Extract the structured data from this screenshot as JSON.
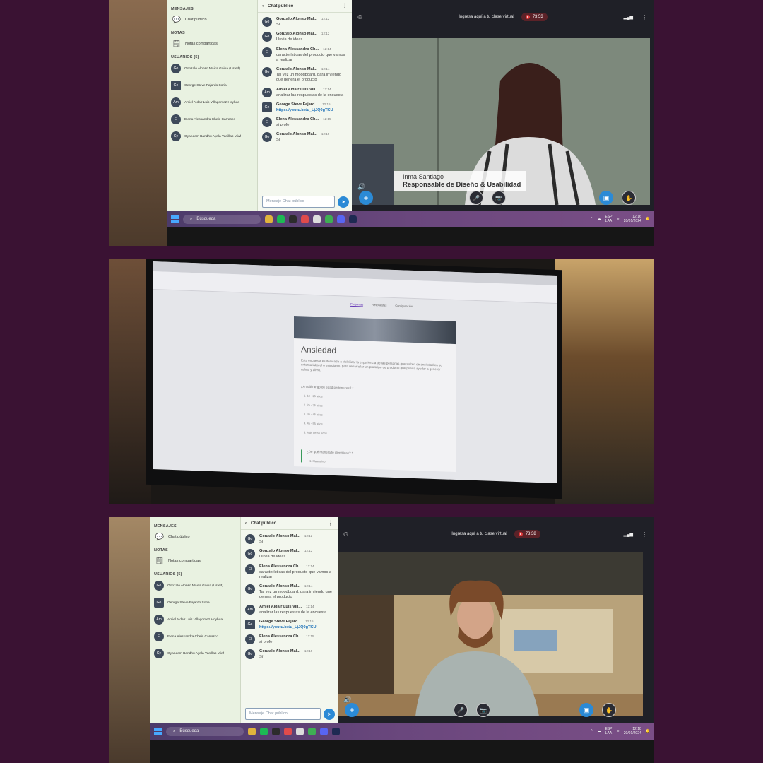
{
  "screens": [
    {
      "left_panel": {
        "messages_heading": "MENSAJES",
        "public_chat": "Chat público",
        "notes_heading": "NOTAS",
        "shared_notes": "Notas compartidas",
        "users_heading": "USUARIOS (5)",
        "users": [
          {
            "initials": "Go",
            "name": "Gonzalo Alonso Maica Goina (Usted)"
          },
          {
            "initials": "Ge",
            "name": "George Steve Fajardo Soria"
          },
          {
            "initials": "Am",
            "name": "Amiel Aldair Luis Villagomez Hoyhua"
          },
          {
            "initials": "El",
            "name": "Elena Alessandra Chele Carrasco"
          },
          {
            "initials": "Gy",
            "name": "Gyandem Bandhu Ayala Vanillas Miwl"
          }
        ]
      },
      "chat": {
        "title": "Chat público",
        "back": "‹",
        "more": "⋮",
        "messages": [
          {
            "initials": "Go",
            "sender": "Gonzalo Alonso Mal...",
            "time": "12:12",
            "text": "Sí"
          },
          {
            "initials": "Go",
            "sender": "Gonzalo Alonso Mal...",
            "time": "12:12",
            "text": "Lluvia de ideas"
          },
          {
            "initials": "El",
            "sender": "Elena Alessandra Ch...",
            "time": "12:14",
            "text": "características del producto que vamos a realizar"
          },
          {
            "initials": "Go",
            "sender": "Gonzalo Alonso Mal...",
            "time": "12:14",
            "text": "Tal vez un moodboard, para ir viendo que genera el producto"
          },
          {
            "initials": "Am",
            "sender": "Amiel Aldair Luis Vill...",
            "time": "12:14",
            "text": "analizar las respuestas de la encuesta"
          },
          {
            "initials": "Ge",
            "sender": "George Steve Fajard...",
            "time": "12:15",
            "text": "https://youtu.be/u_LjJQ0gTKU",
            "link": true
          },
          {
            "initials": "El",
            "sender": "Elena Alessandra Ch...",
            "time": "12:15",
            "text": "si profe"
          },
          {
            "initials": "Go",
            "sender": "Gonzalo Alonso Mal...",
            "time": "12:15",
            "text": "Sí"
          }
        ],
        "input_placeholder": "Mensaje Chat público",
        "send_icon": "➤"
      },
      "video": {
        "header_text": "Ingresa aquí a tu clase virtual",
        "timer": "73:53",
        "signal": "▂▄▆",
        "kebab": "⋮",
        "users_icon": "⚇",
        "banner_name": "Inma Santiago",
        "banner_role": "Responsable de Diseño & Usabilidad",
        "volume_icon": "🔊",
        "plus_icon": "+",
        "mic_icon": "🎤",
        "cam_icon": "📷",
        "share_icon": "▣",
        "hand_icon": "✋"
      },
      "taskbar": {
        "search_label": "Búsqueda",
        "lang_top": "ESP",
        "lang_bottom": "LAA",
        "time": "12:16",
        "date": "20/01/2024"
      }
    },
    {
      "left_panel": {
        "messages_heading": "MENSAJES",
        "public_chat": "Chat público",
        "notes_heading": "NOTAS",
        "shared_notes": "Notas compartidas",
        "users_heading": "USUARIOS (5)",
        "users": [
          {
            "initials": "Go",
            "name": "Gonzalo Alonso Maica Goina (Usted)"
          },
          {
            "initials": "Ge",
            "name": "George Steve Fajardo Soria"
          },
          {
            "initials": "Am",
            "name": "Amiel Aldair Luis Villagomez Hoyhua"
          },
          {
            "initials": "El",
            "name": "Elena Alessandra Chele Carrasco"
          },
          {
            "initials": "Gy",
            "name": "Gyandem Bandhu Ayala Vanillas Miwl"
          }
        ]
      },
      "chat": {
        "title": "Chat público",
        "back": "‹",
        "more": "⋮",
        "messages": [
          {
            "initials": "Go",
            "sender": "Gonzalo Alonso Mal...",
            "time": "12:12",
            "text": "Sí"
          },
          {
            "initials": "Go",
            "sender": "Gonzalo Alonso Mal...",
            "time": "12:12",
            "text": "Lluvia de ideas"
          },
          {
            "initials": "El",
            "sender": "Elena Alessandra Ch...",
            "time": "12:14",
            "text": "características del producto que vamos a realizar"
          },
          {
            "initials": "Go",
            "sender": "Gonzalo Alonso Mal...",
            "time": "12:14",
            "text": "Tal vez un moodboard, para ir viendo que genera el producto"
          },
          {
            "initials": "Am",
            "sender": "Amiel Aldair Luis Vill...",
            "time": "12:14",
            "text": "analizar las respuestas de la encuesta"
          },
          {
            "initials": "Ge",
            "sender": "George Steve Fajard...",
            "time": "12:15",
            "text": "https://youtu.be/u_LjJQ0gTKU",
            "link": true
          },
          {
            "initials": "El",
            "sender": "Elena Alessandra Ch...",
            "time": "12:15",
            "text": "si profe"
          },
          {
            "initials": "Go",
            "sender": "Gonzalo Alonso Mal...",
            "time": "12:15",
            "text": "Sí"
          }
        ],
        "input_placeholder": "Mensaje Chat público",
        "send_icon": "➤"
      },
      "video": {
        "header_text": "Ingresa aquí a tu clase virtual",
        "timer": "73:38",
        "signal": "▂▄▆",
        "kebab": "⋮",
        "users_icon": "⚇",
        "volume_icon": "🔊",
        "plus_icon": "+",
        "mic_icon": "🎤",
        "cam_icon": "📷",
        "share_icon": "▣",
        "hand_icon": "✋"
      },
      "taskbar": {
        "search_label": "Búsqueda",
        "lang_top": "ESP",
        "lang_bottom": "LAA",
        "time": "12:18",
        "date": "20/01/2024"
      }
    }
  ],
  "form": {
    "tabs": [
      "Preguntas",
      "Respuestas",
      "Configuración"
    ],
    "title": "Ansiedad",
    "description": "Esta encuesta es dedicada a visibilizar la experiencia de las personas que sufren de ansiedad en su entorno laboral o estudiantil, para desarrollar un prototipo de producto que pueda ayudar a generar calma y alivio.",
    "question1": "¿A cuál rango de edad perteneces? *",
    "options": [
      "1. 18 - 25 años",
      "2. 25 - 35 años",
      "3. 36 - 45 años",
      "4. 45 - 55 años",
      "5. Más de 56 años"
    ],
    "question2": "¿De qué manera te identificas? *",
    "option_first": "1. Masculino"
  }
}
